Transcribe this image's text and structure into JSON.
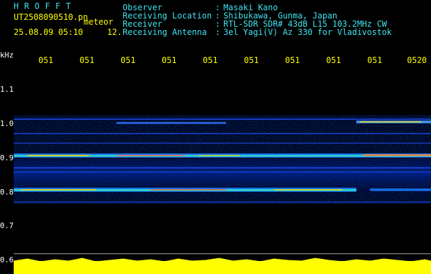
{
  "header": {
    "title": "HROFFT",
    "filename": "UT2508090510.pn",
    "type": "meteor",
    "date": "25.08.09 05:10",
    "count": "12.",
    "fields": [
      {
        "label": "Observer",
        "value": "Masaki Kano"
      },
      {
        "label": "Receiving Location",
        "value": "Shibukawa, Gunma, Japan"
      },
      {
        "label": "Receiver",
        "value": "RTL-SDR SDR# 43dB L15 103.2MHz CW"
      },
      {
        "label": "Receiving Antenna",
        "value": "3el Yagi(V) Az 330 for Vladivostok"
      }
    ],
    "separator": ":"
  },
  "axis": {
    "unit": "kHz",
    "y_ticks": [
      "1.1",
      "1.0",
      "0.9",
      "0.8",
      "0.7",
      "0.6"
    ],
    "x_ticks": [
      "051",
      "051",
      "051",
      "051",
      "051",
      "051",
      "051",
      "051",
      "051",
      "0520"
    ]
  },
  "colors": {
    "background": "#000000",
    "label_cyan": "#3ee4f0",
    "tick_yellow": "#ffff00",
    "spectrum_yellow": "#ffff00"
  }
}
